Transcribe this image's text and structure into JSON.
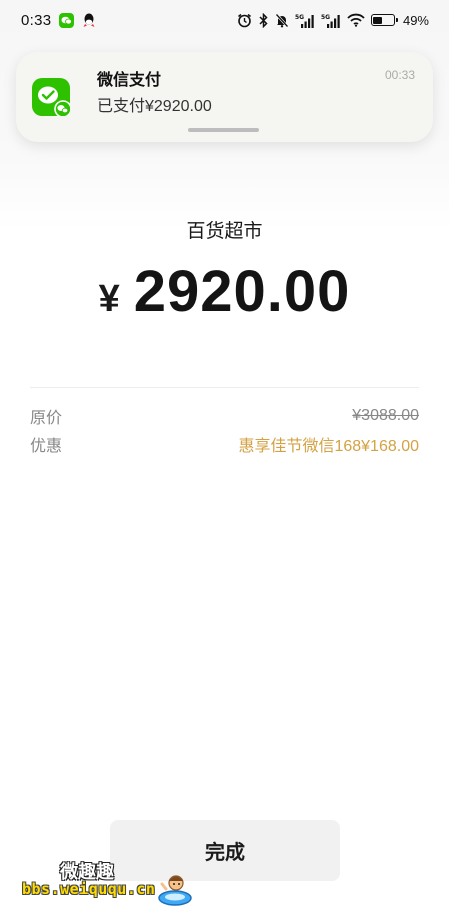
{
  "status_bar": {
    "time": "0:33",
    "battery_percent": "49%",
    "battery_level": 0.49,
    "network": "5G",
    "icons": [
      "wechat-icon",
      "qq-icon",
      "alarm-icon",
      "bluetooth-icon",
      "mute-icon",
      "signal-icon",
      "signal-icon",
      "wifi-icon",
      "battery-icon"
    ]
  },
  "notification": {
    "app_name": "微信支付",
    "message": "已支付¥2920.00",
    "time": "00:33",
    "icon": "wechat-pay-icon"
  },
  "payment": {
    "merchant": "百货超市",
    "currency_symbol": "¥",
    "amount": "2920.00"
  },
  "details": {
    "original_label": "原价",
    "original_value": "¥3088.00",
    "discount_label": "优惠",
    "discount_value": "惠享佳节微信168¥168.00"
  },
  "done_button": {
    "label": "完成"
  },
  "watermark": {
    "top_text": "微趣趣",
    "url": "bbs.weiququ.cn"
  },
  "colors": {
    "wechat_green": "#2dc100",
    "discount_gold": "#d4a244",
    "button_bg": "#f1f1f1"
  }
}
